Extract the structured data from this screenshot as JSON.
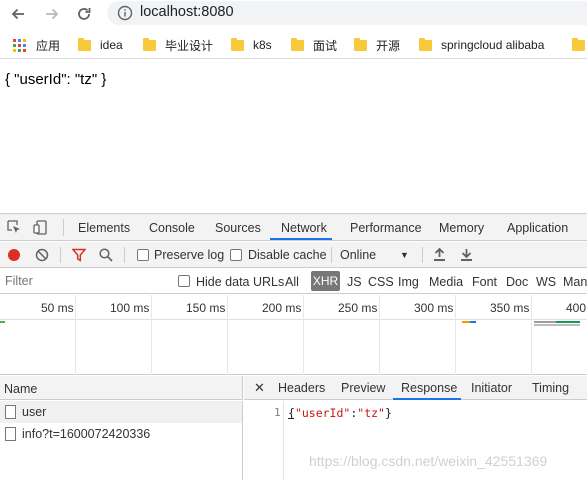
{
  "browser": {
    "url_host": "localhost",
    "url_port": ":8080"
  },
  "bookmarks": {
    "apps_label": "应用",
    "items": [
      {
        "label": "idea"
      },
      {
        "label": "毕业设计"
      },
      {
        "label": "k8s"
      },
      {
        "label": "面试"
      },
      {
        "label": "开源"
      },
      {
        "label": "springcloud alibaba"
      }
    ]
  },
  "page": {
    "json_text": "{ \"userId\": \"tz\" }"
  },
  "devtools": {
    "tabs": [
      {
        "label": "Elements"
      },
      {
        "label": "Console"
      },
      {
        "label": "Sources"
      },
      {
        "label": "Network",
        "active": true
      },
      {
        "label": "Performance"
      },
      {
        "label": "Memory"
      },
      {
        "label": "Application"
      }
    ],
    "toolbar": {
      "preserve_log": "Preserve log",
      "disable_cache": "Disable cache",
      "throttle": "Online",
      "preserve_log_checked": false,
      "disable_cache_checked": false
    },
    "filter": {
      "placeholder": "Filter",
      "hide_data_urls": "Hide data URLs",
      "types": [
        "All",
        "XHR",
        "JS",
        "CSS",
        "Img",
        "Media",
        "Font",
        "Doc",
        "WS",
        "Manifest"
      ],
      "active_type": "XHR"
    },
    "timeline": {
      "ticks": [
        "50 ms",
        "100 ms",
        "150 ms",
        "200 ms",
        "250 ms",
        "300 ms",
        "350 ms",
        "400"
      ]
    },
    "requests": {
      "header": "Name",
      "rows": [
        {
          "name": "user"
        },
        {
          "name": "info?t=1600072420336"
        }
      ]
    },
    "detail": {
      "tabs": [
        {
          "label": "Headers"
        },
        {
          "label": "Preview"
        },
        {
          "label": "Response",
          "active": true
        },
        {
          "label": "Initiator"
        },
        {
          "label": "Timing"
        }
      ],
      "line_number": "1",
      "response_body": {
        "open": "{",
        "key": "\"userId\"",
        "colon": ":",
        "value": "\"tz\"",
        "close": "}"
      }
    }
  },
  "watermark": "https://blog.csdn.net/weixin_42551369",
  "colors": {
    "accent": "#1a73e8",
    "record": "#d93025",
    "filter_red": "#d93025",
    "string_red": "#c41a16",
    "folder": "#f8c93a"
  }
}
